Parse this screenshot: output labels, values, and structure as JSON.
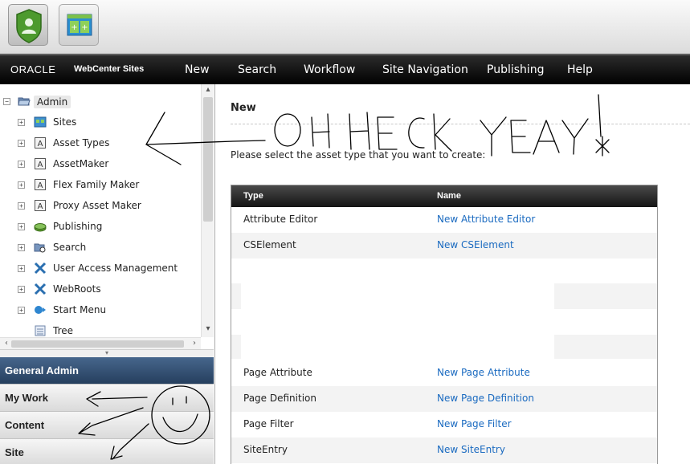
{
  "toolbar": {
    "buttons": [
      {
        "icon": "admin-shield-icon",
        "active": true
      },
      {
        "icon": "contributor-grid-icon",
        "active": false
      }
    ]
  },
  "navbar": {
    "brand_oracle": "ORACLE",
    "brand_product": "WebCenter Sites",
    "items": [
      "New",
      "Search",
      "Workflow",
      "Site Navigation",
      "Publishing",
      "Help"
    ]
  },
  "tree": {
    "root": "Admin",
    "items": [
      {
        "label": "Sites",
        "icon": "sites-icon"
      },
      {
        "label": "Asset Types",
        "icon": "asset-type-icon"
      },
      {
        "label": "AssetMaker",
        "icon": "asset-type-icon"
      },
      {
        "label": "Flex Family Maker",
        "icon": "asset-type-icon"
      },
      {
        "label": "Proxy Asset Maker",
        "icon": "asset-type-icon"
      },
      {
        "label": "Publishing",
        "icon": "publishing-icon"
      },
      {
        "label": "Search",
        "icon": "search-folder-icon"
      },
      {
        "label": "User Access Management",
        "icon": "tools-icon"
      },
      {
        "label": "WebRoots",
        "icon": "tools-icon"
      },
      {
        "label": "Start Menu",
        "icon": "start-menu-icon"
      },
      {
        "label": "Tree",
        "icon": "tree-icon"
      }
    ]
  },
  "accordion": {
    "general_admin": "General Admin",
    "my_work": "My Work",
    "content": "Content",
    "site": "Site"
  },
  "main": {
    "title": "New",
    "instructions": "Please select the asset type that you want to create:",
    "table": {
      "headers": [
        "Type",
        "Name"
      ],
      "rows": [
        {
          "type": "Attribute Editor",
          "name": "New Attribute Editor"
        },
        {
          "type": "CSElement",
          "name": "New CSElement"
        },
        {
          "type": "Page Attribute",
          "name": "New Page Attribute"
        },
        {
          "type": "Page Definition",
          "name": "New Page Definition"
        },
        {
          "type": "Page Filter",
          "name": "New Page Filter"
        },
        {
          "type": "SiteEntry",
          "name": "New SiteEntry"
        }
      ]
    }
  },
  "annotation": {
    "text": "OH HECK YEAY!",
    "color": "#000000"
  },
  "colors": {
    "link": "#1a6ac0",
    "accordion_active": "#34527a",
    "navbar": "#111111"
  }
}
